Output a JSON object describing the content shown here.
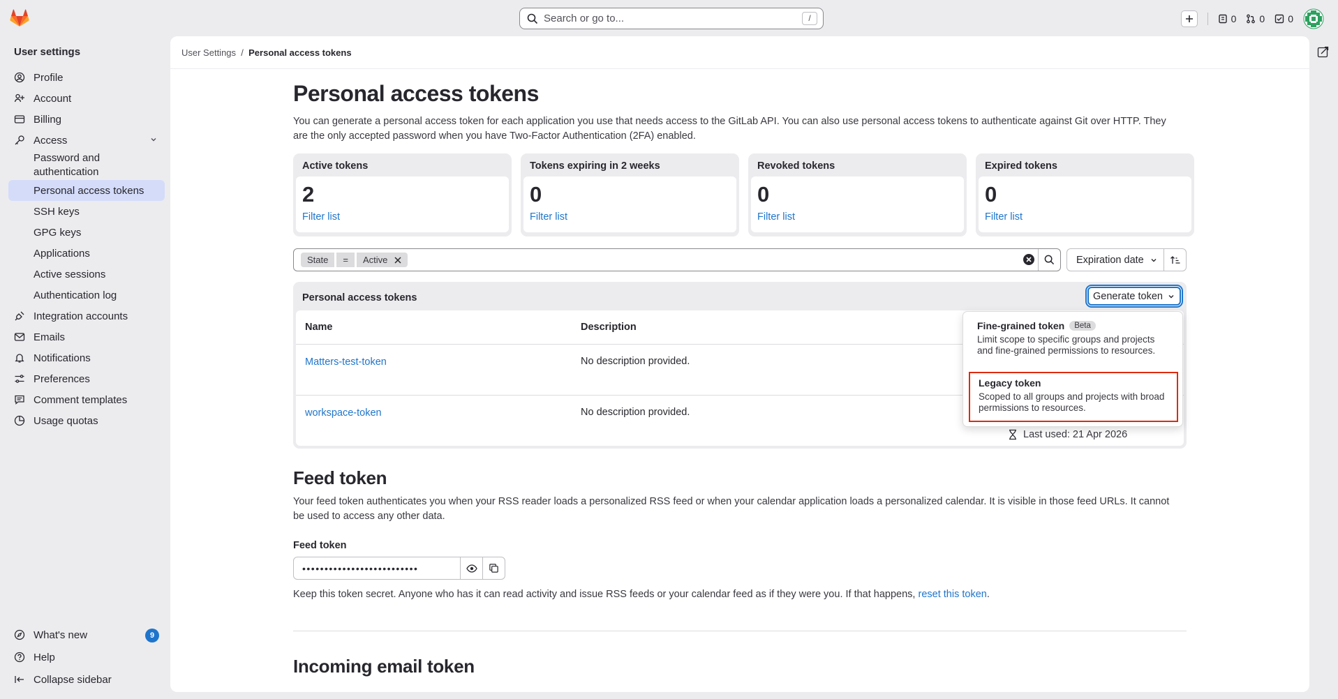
{
  "topbar": {
    "search_placeholder": "Search or go to...",
    "search_shortcut": "/",
    "issues_count": "0",
    "mr_count": "0",
    "todo_count": "0"
  },
  "sidebar": {
    "title": "User settings",
    "items": [
      "Profile",
      "Account",
      "Billing",
      "Access"
    ],
    "access_sub": [
      "Password and authentication",
      "Personal access tokens",
      "SSH keys",
      "GPG keys",
      "Applications",
      "Active sessions",
      "Authentication log"
    ],
    "items2": [
      "Integration accounts",
      "Emails",
      "Notifications",
      "Preferences",
      "Comment templates",
      "Usage quotas"
    ],
    "whats_new": "What's new",
    "whats_new_count": "9",
    "help": "Help",
    "collapse": "Collapse sidebar"
  },
  "breadcrumb": {
    "root": "User Settings",
    "sep": "/",
    "current": "Personal access tokens"
  },
  "page": {
    "title": "Personal access tokens",
    "description": "You can generate a personal access token for each application you use that needs access to the GitLab API. You can also use personal access tokens to authenticate against Git over HTTP. They are the only accepted password when you have Two-Factor Authentication (2FA) enabled."
  },
  "cards": [
    {
      "title": "Active tokens",
      "value": "2",
      "link": "Filter list"
    },
    {
      "title": "Tokens expiring in 2 weeks",
      "value": "0",
      "link": "Filter list"
    },
    {
      "title": "Revoked tokens",
      "value": "0",
      "link": "Filter list"
    },
    {
      "title": "Expired tokens",
      "value": "0",
      "link": "Filter list"
    }
  ],
  "filter": {
    "token_key": "State",
    "token_op": "=",
    "token_value": "Active",
    "sort_label": "Expiration date"
  },
  "tokens_panel": {
    "title": "Personal access tokens",
    "generate_label": "Generate token",
    "col_name": "Name",
    "col_description": "Description",
    "rows": [
      {
        "name": "Matters-test-token",
        "description": "No description provided."
      },
      {
        "name": "workspace-token",
        "description": "No description provided."
      }
    ],
    "last_used": "Last used: 21 Apr 2026"
  },
  "dropdown": {
    "fine_title": "Fine-grained token",
    "fine_badge": "Beta",
    "fine_desc": "Limit scope to specific groups and projects and fine-grained permissions to resources.",
    "legacy_title": "Legacy token",
    "legacy_desc": "Scoped to all groups and projects with broad permissions to resources."
  },
  "feed": {
    "title": "Feed token",
    "description": "Your feed token authenticates you when your RSS reader loads a personalized RSS feed or when your calendar application loads a personalized calendar. It is visible in those feed URLs. It cannot be used to access any other data.",
    "label": "Feed token",
    "masked": "••••••••••••••••••••••••••",
    "help_text": "Keep this token secret. Anyone who has it can read activity and issue RSS feeds or your calendar feed as if they were you. If that happens,",
    "reset_link": "reset this token",
    "period": "."
  },
  "incoming": {
    "title": "Incoming email token"
  }
}
